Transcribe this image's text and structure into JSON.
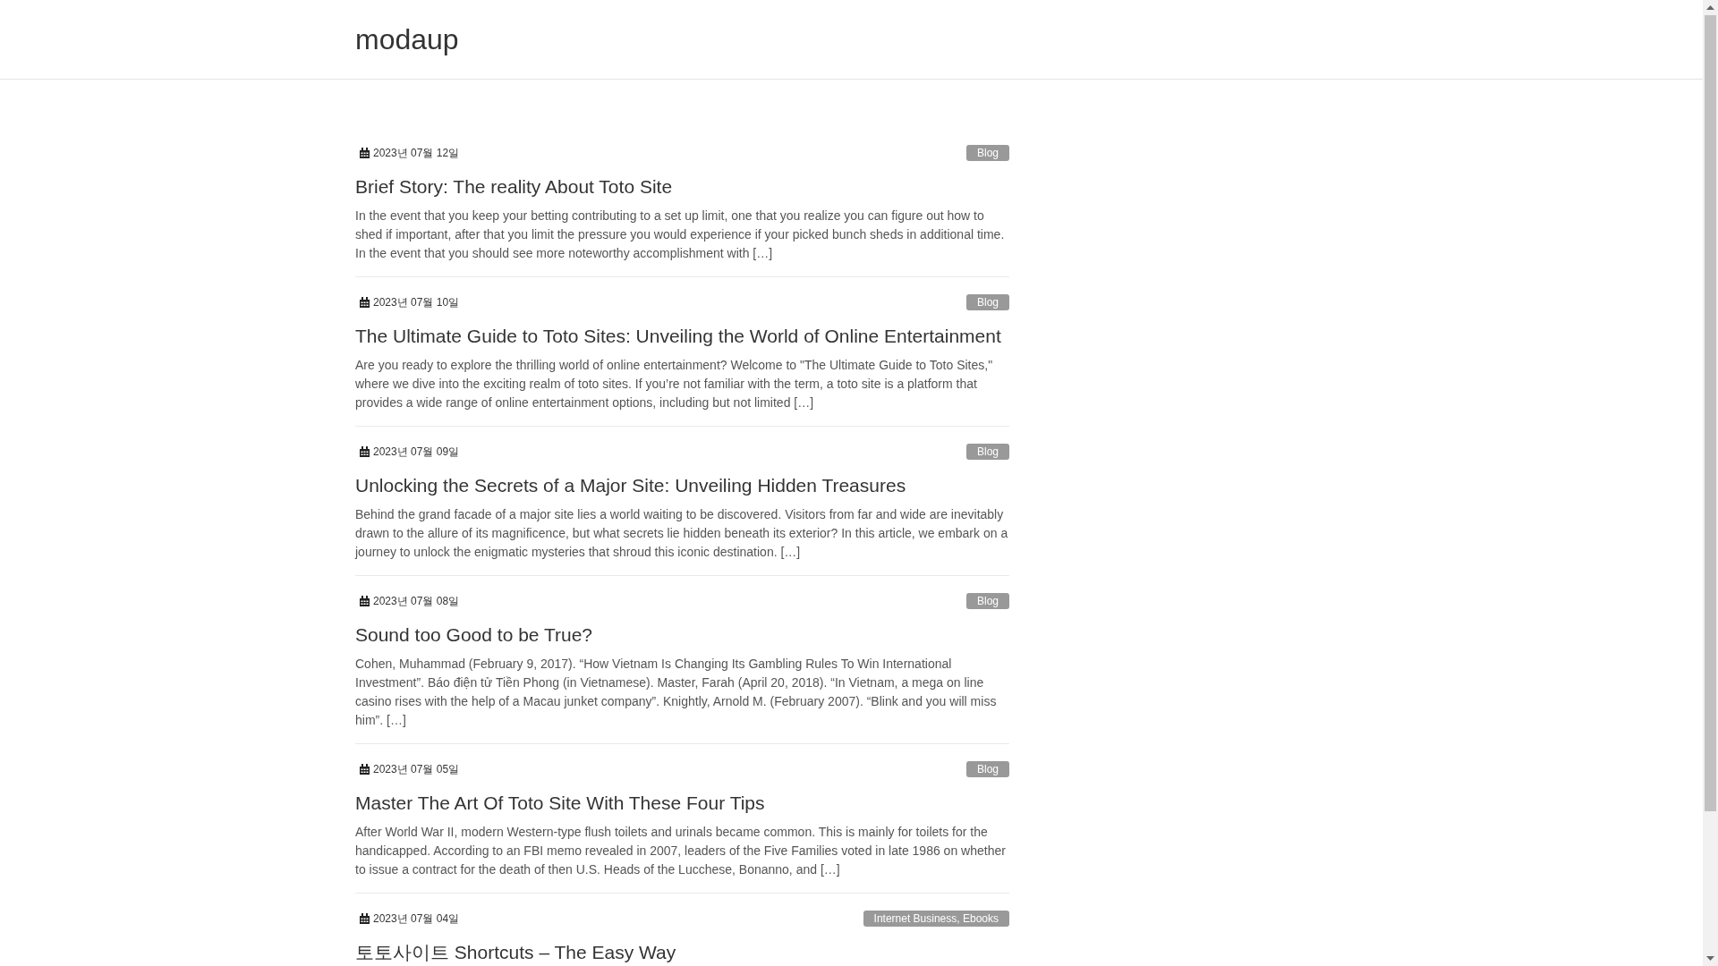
{
  "site": {
    "title": "modaup"
  },
  "posts": [
    {
      "date": "2023년 07월 12일",
      "category": "Blog",
      "title": "Brief Story: The reality About Toto Site",
      "excerpt": "In the event that you keep your betting contributing to a set up limit, one that you realize you can figure out how to shed if important, after that you limit the pressure you would experience if your picked bunch sheds in additional time. In the event that you should see more noteworthy accomplishment with […]"
    },
    {
      "date": "2023년 07월 10일",
      "category": "Blog",
      "title": "The Ultimate Guide to Toto Sites: Unveiling the World of Online Entertainment",
      "excerpt": "Are you ready to explore the thrilling world of online entertainment? Welcome to \"The Ultimate Guide to Toto Sites,\" where we dive into the exciting realm of toto sites. If you’re not familiar with the term, a toto site is a platform that provides a wide range of online entertainment options, including but not limited […]"
    },
    {
      "date": "2023년 07월 09일",
      "category": "Blog",
      "title": "Unlocking the Secrets of a Major Site: Unveiling Hidden Treasures",
      "excerpt": "Behind the grand facade of a major site lies a world waiting to be discovered. Visitors from far and wide are inevitably drawn to the allure of its magnificence, but what secrets lie hidden beneath its exterior? In this article, we embark on a journey to unlock the enigmatic mysteries that shroud this iconic destination. […]"
    },
    {
      "date": "2023년 07월 08일",
      "category": "Blog",
      "title": "Sound too Good to be True?",
      "excerpt": "Cohen, Muhammad (February 9, 2017). “How Vietnam Is Changing Its Gambling Rules To Win International Investment”. Báo điện tử Tiền Phong (in Vietnamese). Master, Farah (April 20, 2018). “In Vietnam, a mega on line casino rises with the help of a Macau junket company”. Knightly, Arnold M. (February 2007). “Blink and you will miss him”. […]"
    },
    {
      "date": "2023년 07월 05일",
      "category": "Blog",
      "title": "Master The Art Of Toto Site With These Four Tips",
      "excerpt": "After World War II, modern Western-type flush toilets and urinals became common. This is mainly for toilets for the handicapped. According to an FBI memo revealed in 2007, leaders of the Five Families voted in late 1986 on whether to issue a contract for the death of then U.S. Heads of the Lucchese, Bonanno, and […]"
    },
    {
      "date": "2023년 07월 04일",
      "category": "Internet Business, Ebooks",
      "title": "토토사이트 Shortcuts – The Easy Way"
    }
  ]
}
